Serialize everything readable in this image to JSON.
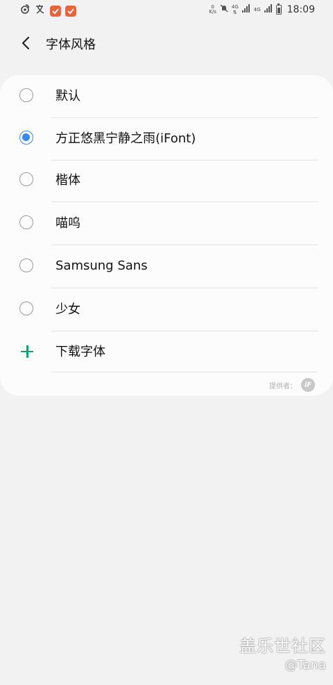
{
  "status_bar": {
    "left_icons": [
      "weibo-icon",
      "translate-icon",
      "check-app-icon",
      "check-app-icon"
    ],
    "net_speed_value": "0",
    "net_speed_unit": "K/s",
    "signal_1": "4G",
    "signal_2": "4G",
    "battery_level": 0.65,
    "time": "18:09"
  },
  "header": {
    "title": "字体风格",
    "back_icon": "chevron-left-icon"
  },
  "font_options": [
    {
      "label": "默认",
      "selected": false
    },
    {
      "label": "方正悠黑宁静之雨(iFont)",
      "selected": true
    },
    {
      "label": "楷体",
      "selected": false
    },
    {
      "label": "喵呜",
      "selected": false
    },
    {
      "label": "Samsung Sans",
      "selected": false
    },
    {
      "label": "少女",
      "selected": false
    }
  ],
  "download": {
    "label": "下载字体",
    "icon": "plus-icon"
  },
  "provider": {
    "label": "提供者：",
    "logo": "iF"
  },
  "watermark": {
    "title": "盖乐世社区",
    "user": "@Tana"
  },
  "colors": {
    "accent": "#3d86ea",
    "add_green": "#13a36a",
    "background": "#f2f2f2",
    "card": "#fcfcfc"
  }
}
